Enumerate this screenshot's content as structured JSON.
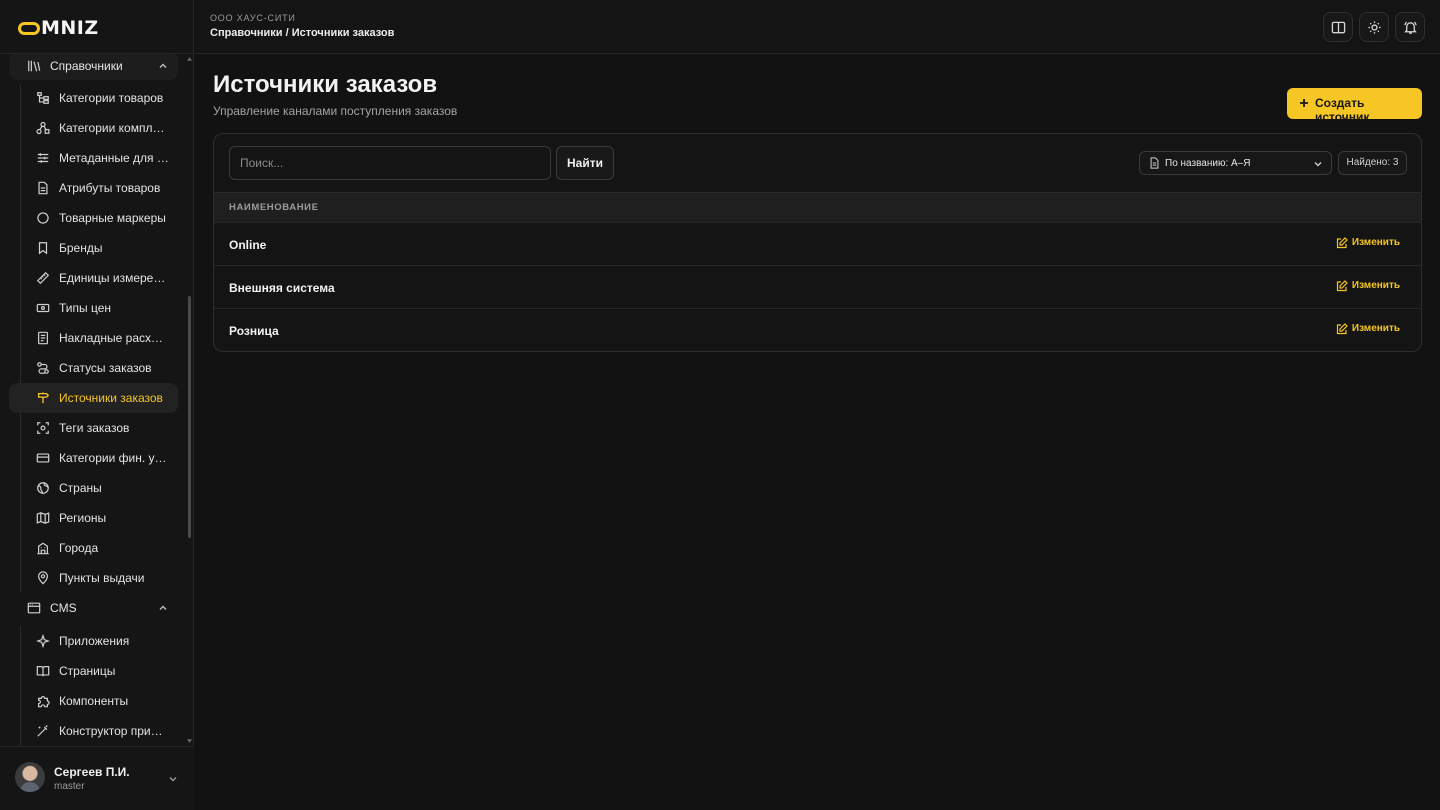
{
  "brand": {
    "logo_text": "MNIZ",
    "accent": "#f6c624"
  },
  "sidebar": {
    "group_directories": {
      "label": "Справочники",
      "icon": "library-icon"
    },
    "directory_items": [
      {
        "label": "Категории товаров",
        "icon": "tree-icon"
      },
      {
        "label": "Категории комплектов",
        "icon": "shapes-icon"
      },
      {
        "label": "Метаданные для витрины",
        "icon": "sliders-icon"
      },
      {
        "label": "Атрибуты товаров",
        "icon": "file-icon"
      },
      {
        "label": "Товарные маркеры",
        "icon": "circle-icon"
      },
      {
        "label": "Бренды",
        "icon": "bookmark-icon"
      },
      {
        "label": "Единицы измерения",
        "icon": "ruler-icon"
      },
      {
        "label": "Типы цен",
        "icon": "banknote-icon"
      },
      {
        "label": "Накладные расходы",
        "icon": "receipt-icon"
      },
      {
        "label": "Статусы заказов",
        "icon": "route-icon"
      },
      {
        "label": "Источники заказов",
        "icon": "signpost-icon",
        "active": true
      },
      {
        "label": "Теги заказов",
        "icon": "scan-icon"
      },
      {
        "label": "Категории фин. учета",
        "icon": "card-icon"
      },
      {
        "label": "Страны",
        "icon": "globe-icon"
      },
      {
        "label": "Регионы",
        "icon": "map-icon"
      },
      {
        "label": "Города",
        "icon": "building-icon"
      },
      {
        "label": "Пункты выдачи",
        "icon": "pin-icon"
      }
    ],
    "group_cms": {
      "label": "CMS",
      "icon": "browser-icon"
    },
    "cms_items": [
      {
        "label": "Приложения",
        "icon": "sparkles-icon"
      },
      {
        "label": "Страницы",
        "icon": "book-icon"
      },
      {
        "label": "Компоненты",
        "icon": "puzzle-icon"
      },
      {
        "label": "Конструктор приложений",
        "icon": "wand-icon"
      }
    ],
    "user": {
      "name": "Сергеев П.И.",
      "role": "master"
    }
  },
  "header": {
    "org": "ООО ХАУС-СИТИ",
    "breadcrumb": "Справочники / Источники заказов"
  },
  "main": {
    "title": "Источники заказов",
    "subtitle": "Управление каналами поступления заказов",
    "create_label": "Создать источник",
    "search": {
      "placeholder": "Поиск...",
      "value": ""
    },
    "find_label": "Найти",
    "sort_label": "По названию: А–Я",
    "found_label": "Найдено: 3",
    "column_header": "НАИМЕНОВАНИЕ",
    "edit_label": "Изменить",
    "rows": [
      {
        "name": "Online"
      },
      {
        "name": "Внешняя система"
      },
      {
        "name": "Розница"
      }
    ]
  }
}
